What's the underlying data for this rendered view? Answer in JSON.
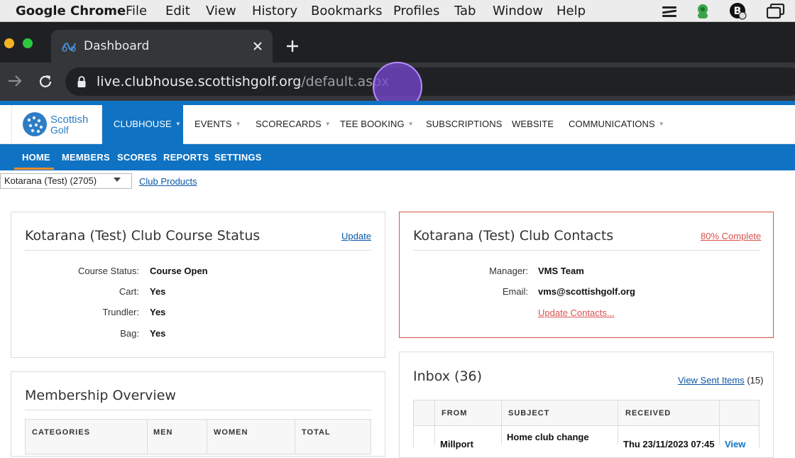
{
  "menubar": {
    "app": "Google Chrome",
    "items": [
      "File",
      "Edit",
      "View",
      "History",
      "Bookmarks",
      "Profiles",
      "Tab",
      "Window",
      "Help"
    ]
  },
  "browser": {
    "tab_title": "Dashboard",
    "url_domain": "live.clubhouse.scottishgolf.org",
    "url_path": "/default.aspx",
    "accent_color": "#7648d2"
  },
  "site": {
    "logo_line1": "Scottish",
    "logo_line2": "Golf",
    "brand_color": "#0f72c2",
    "topnav": [
      {
        "label": "CLUBHOUSE",
        "caret": true
      },
      {
        "label": "EVENTS",
        "caret": true
      },
      {
        "label": "SCORECARDS",
        "caret": true
      },
      {
        "label": "TEE BOOKING",
        "caret": true
      },
      {
        "label": "SUBSCRIPTIONS",
        "caret": false
      },
      {
        "label": "WEBSITE",
        "caret": false
      },
      {
        "label": "COMMUNICATIONS",
        "caret": true
      }
    ],
    "subnav": [
      "HOME",
      "MEMBERS",
      "SCORES",
      "REPORTS",
      "SETTINGS"
    ],
    "club_select": "Kotarana (Test) (2705)",
    "club_products": "Club Products"
  },
  "course_status": {
    "title": "Kotarana (Test) Club Course Status",
    "update_link": "Update",
    "rows": [
      {
        "label": "Course Status:",
        "value": "Course Open"
      },
      {
        "label": "Cart:",
        "value": "Yes"
      },
      {
        "label": "Trundler:",
        "value": "Yes"
      },
      {
        "label": "Bag:",
        "value": "Yes"
      }
    ]
  },
  "contacts": {
    "title": "Kotarana (Test) Club Contacts",
    "complete_link": "80% Complete",
    "rows": [
      {
        "label": "Manager:",
        "value": "VMS Team"
      },
      {
        "label": "Email:",
        "value": "vms@scottishgolf.org"
      }
    ],
    "update_link": "Update Contacts..."
  },
  "membership": {
    "title": "Membership Overview",
    "headers": [
      "CATEGORIES",
      "MEN",
      "WOMEN",
      "TOTAL"
    ]
  },
  "inbox": {
    "title": "Inbox (36)",
    "sent_link": "View Sent Items",
    "sent_count": "(15)",
    "headers": [
      "FROM",
      "SUBJECT",
      "RECEIVED"
    ],
    "row": {
      "from": "Millport",
      "subject": "Home club change",
      "received": "Thu 23/11/2023 07:45",
      "action": "View"
    }
  }
}
